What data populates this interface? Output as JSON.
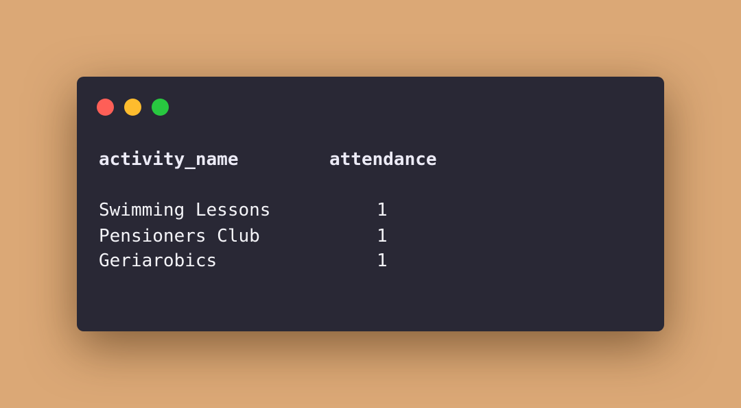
{
  "window": {
    "controls": {
      "close_color": "#fe5f57",
      "minimize_color": "#febc2e",
      "maximize_color": "#28c840"
    }
  },
  "table": {
    "columns": [
      "activity_name",
      "attendance"
    ],
    "rows": [
      {
        "activity_name": "Swimming Lessons",
        "attendance": "1"
      },
      {
        "activity_name": "Pensioners Club",
        "attendance": "1"
      },
      {
        "activity_name": "Geriarobics",
        "attendance": "1"
      }
    ]
  }
}
